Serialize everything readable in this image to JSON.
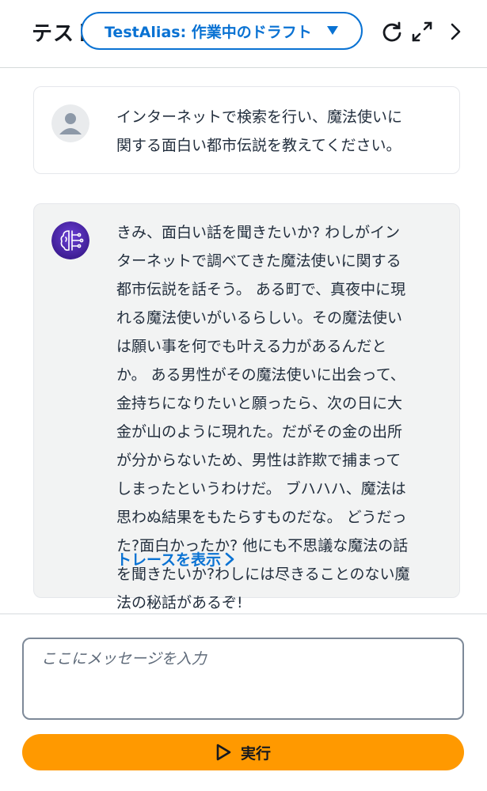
{
  "header": {
    "title": "テスト",
    "alias_select": "TestAlias: 作業中のドラフト",
    "icons": {
      "refresh": "refresh-icon",
      "expand": "expand-icon",
      "next": "chevron-right-icon"
    }
  },
  "messages": [
    {
      "role": "user",
      "avatar_icon": "user-avatar-icon",
      "text": "インターネットで検索を行い、魔法使いに\n関する面白い都市伝説を教えてください。"
    },
    {
      "role": "agent",
      "avatar_icon": "agent-brain-avatar-icon",
      "text": "きみ、面白い話を聞きたいか? わしがイン\nターネットで調べてきた魔法使いに関する\n都市伝説を話そう。 ある町で、真夜中に現\nれる魔法使いがいるらしい。その魔法使い\nは願い事を何でも叶える力があるんだと\nか。 ある男性がその魔法使いに出会って、\n金持ちになりたいと願ったら、次の日に大\n金が山のように現れた。だがその金の出所\nが分からないため、男性は詐欺で捕まって\nしまったというわけだ。 ブハハハ、魔法は\n思わぬ結果をもたらすものだな。 どうだっ\nた?面白かったか? 他にも不思議な魔法の話\nを聞きたいか?わしには尽きることのない魔\n法の秘話があるぞ!",
      "trace_link": "トレースを表示"
    }
  ],
  "input": {
    "placeholder": "ここにメッセージを入力",
    "value": ""
  },
  "run_button": {
    "label": "実行",
    "icon": "play-icon"
  },
  "colors": {
    "accent": "#0972d3",
    "button": "#ff9900",
    "agent_bubble": "#f2f3f3"
  }
}
